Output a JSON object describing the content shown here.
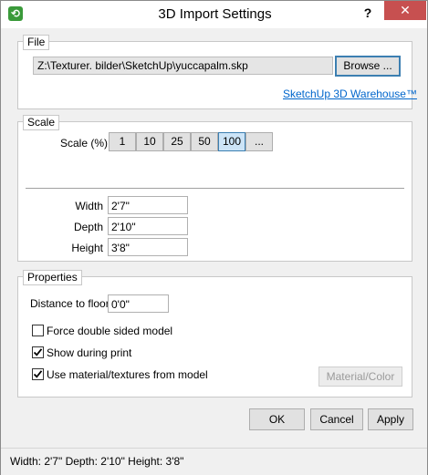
{
  "window": {
    "title": "3D Import Settings",
    "help_label": "?",
    "close_label": "✕"
  },
  "file_group": {
    "legend": "File",
    "path": "Z:\\Texturer. bilder\\SketchUp\\yuccapalm.skp",
    "browse_label": "Browse ...",
    "warehouse_link": "SketchUp 3D Warehouse™"
  },
  "scale_group": {
    "legend": "Scale",
    "scale_label": "Scale (%)",
    "scale_options": [
      "1",
      "10",
      "25",
      "50",
      "100",
      "..."
    ],
    "selected_scale": "100",
    "width_label": "Width",
    "width_value": "2'7\"",
    "depth_label": "Depth",
    "depth_value": "2'10\"",
    "height_label": "Height",
    "height_value": "3'8\""
  },
  "properties_group": {
    "legend": "Properties",
    "distance_label": "Distance to floor",
    "distance_value": "0'0\"",
    "force_double_label": "Force double sided model",
    "force_double_checked": false,
    "show_print_label": "Show during print",
    "show_print_checked": true,
    "use_material_label": "Use material/textures from model",
    "use_material_checked": true,
    "material_color_label": "Material/Color"
  },
  "buttons": {
    "ok": "OK",
    "cancel": "Cancel",
    "apply": "Apply"
  },
  "status": {
    "text": "Width: 2'7\"  Depth: 2'10\"  Height: 3'8\""
  }
}
